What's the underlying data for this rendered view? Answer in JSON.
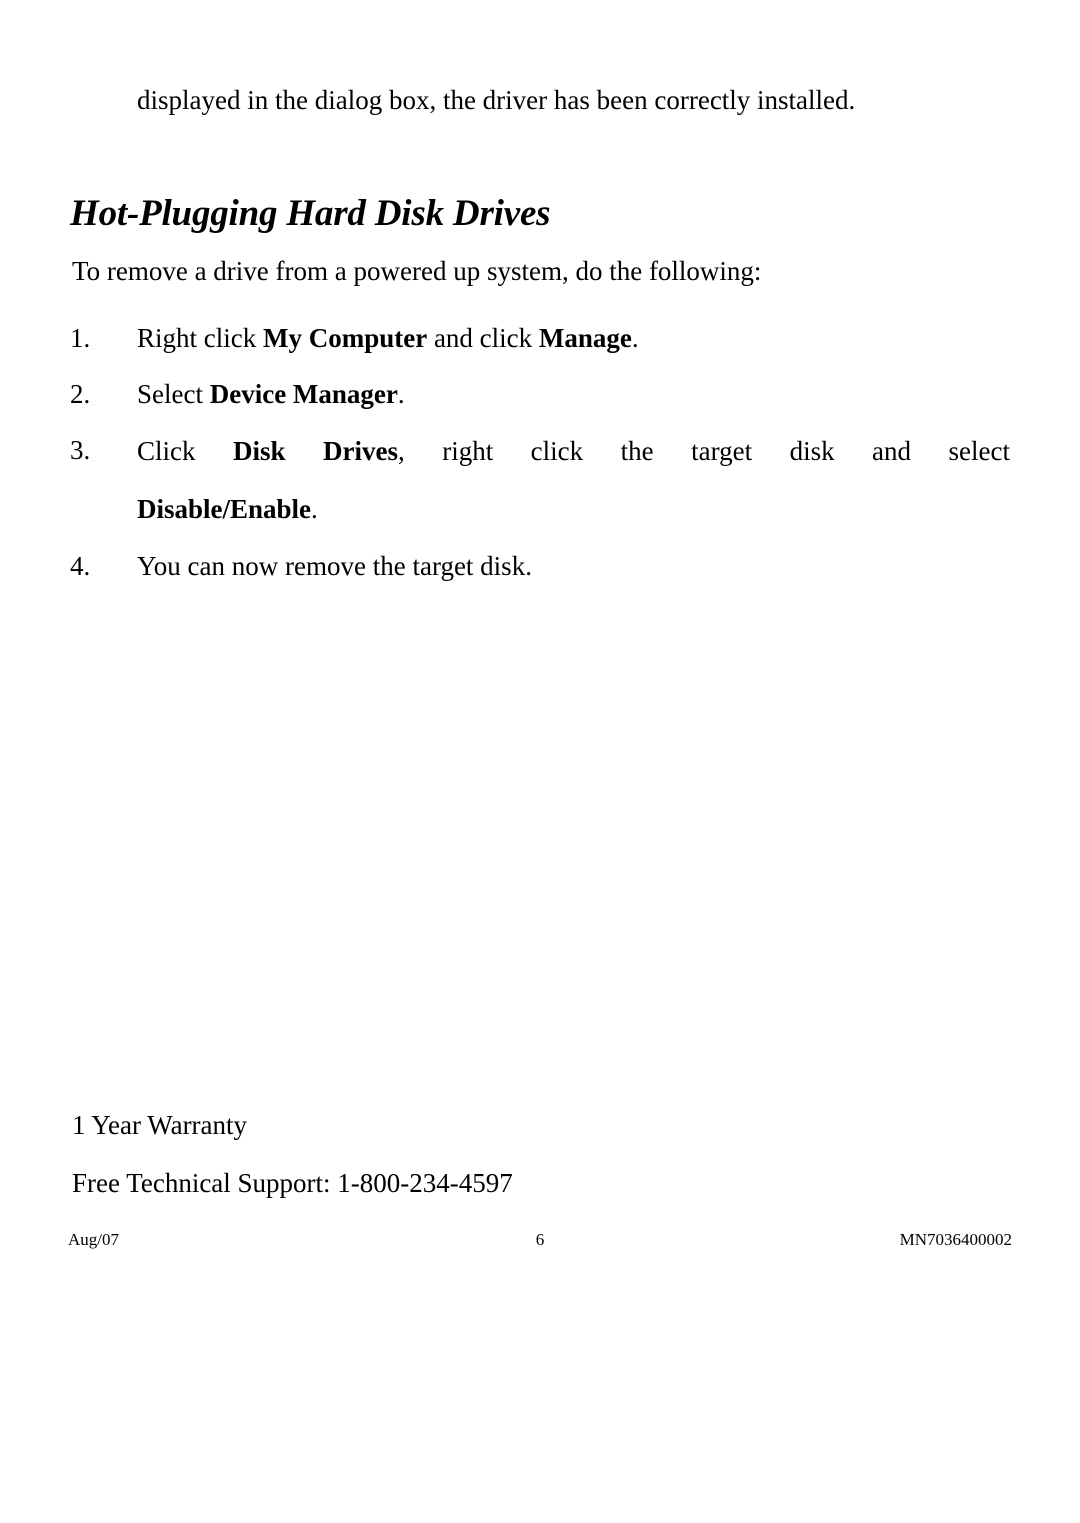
{
  "document": {
    "continuation_line": "displayed in the dialog box, the driver has been correctly installed.",
    "heading": "Hot-Plugging Hard Disk Drives",
    "intro": "To remove a drive from a powered up system, do the following:",
    "steps": [
      {
        "number": "1.",
        "parts": [
          {
            "text": "Right click ",
            "bold": false
          },
          {
            "text": "My Computer",
            "bold": true
          },
          {
            "text": " and click ",
            "bold": false
          },
          {
            "text": "Manage",
            "bold": true
          },
          {
            "text": ".",
            "bold": false
          }
        ],
        "plain": "Right click My Computer and click Manage."
      },
      {
        "number": "2.",
        "parts": [
          {
            "text": "Select ",
            "bold": false
          },
          {
            "text": "Device Manager",
            "bold": true
          },
          {
            "text": ".",
            "bold": false
          }
        ],
        "plain": "Select Device Manager."
      },
      {
        "number": "3.",
        "parts": [
          {
            "text": "Click ",
            "bold": false
          },
          {
            "text": "Disk Drives",
            "bold": true
          },
          {
            "text": ", right click the target disk and select ",
            "bold": false
          },
          {
            "text": "Disable/Enable",
            "bold": true
          },
          {
            "text": ".",
            "bold": false
          }
        ],
        "plain": "Click Disk Drives, right click the target disk and select Disable/Enable."
      },
      {
        "number": "4.",
        "parts": [
          {
            "text": "You can now remove the target disk.",
            "bold": false
          }
        ],
        "plain": "You can now remove the target disk."
      }
    ],
    "step3_line1_segments": {
      "click": "Click ",
      "disk_drives": "Disk Drives",
      "rest": ", right click the target disk and select"
    },
    "step3_line2_segments": {
      "disable_enable": "Disable/Enable",
      "period": "."
    },
    "warranty": "1 Year Warranty",
    "support": "Free Technical Support: 1-800-234-4597",
    "footer": {
      "date": "Aug/07",
      "page_number": "6",
      "doc_code": "MN7036400002"
    }
  }
}
